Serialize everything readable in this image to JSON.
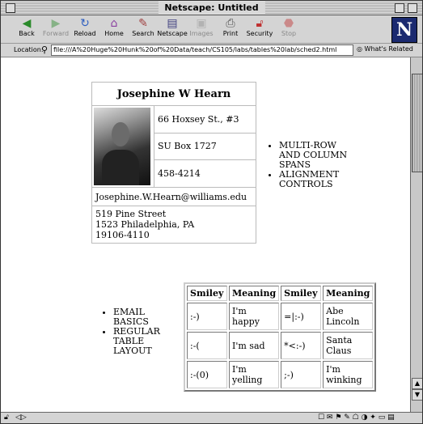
{
  "window": {
    "title": "Netscape: Untitled"
  },
  "toolbar": {
    "buttons": [
      {
        "label": "Back",
        "icon": "back-arrow-icon",
        "enabled": true
      },
      {
        "label": "Forward",
        "icon": "forward-arrow-icon",
        "enabled": false
      },
      {
        "label": "Reload",
        "icon": "reload-icon",
        "enabled": true
      },
      {
        "label": "Home",
        "icon": "home-icon",
        "enabled": true
      },
      {
        "label": "Search",
        "icon": "search-icon",
        "enabled": true
      },
      {
        "label": "Netscape",
        "icon": "netscape-icon",
        "enabled": true
      },
      {
        "label": "Images",
        "icon": "images-icon",
        "enabled": false
      },
      {
        "label": "Print",
        "icon": "print-icon",
        "enabled": true
      },
      {
        "label": "Security",
        "icon": "security-lock-icon",
        "enabled": true
      },
      {
        "label": "Stop",
        "icon": "stop-icon",
        "enabled": false
      }
    ],
    "logo_letter": "N"
  },
  "location": {
    "label": "Location:",
    "url": "file:///A%20Huge%20Hunk%20of%20Data/teach/CS105/labs/tables%20lab/sched2.html",
    "related": "What's Related"
  },
  "card": {
    "name": "Josephine W Hearn",
    "address": "66 Hoxsey St., #3",
    "su_box": "SU Box 1727",
    "phone": "458-4214",
    "email": "Josephine.W.Hearn@williams.edu",
    "home_line1": "519 Pine Street",
    "home_line2": "1523 Philadelphia, PA",
    "home_line3": "19106-4110"
  },
  "bullets_top": [
    "MULTI-ROW AND COLUMN SPANS",
    "ALIGNMENT CONTROLS"
  ],
  "bullets_bottom": [
    "EMAIL BASICS",
    "REGULAR TABLE LAYOUT"
  ],
  "smiley_table": {
    "headers": [
      "Smiley",
      "Meaning",
      "Smiley",
      "Meaning"
    ],
    "rows": [
      [
        ":-)",
        "I'm happy",
        "=|:-)",
        "Abe Lincoln"
      ],
      [
        ":-(",
        "I'm sad",
        "*<:-)",
        "Santa Claus"
      ],
      [
        ":-(0)",
        "I'm yelling",
        ";-)",
        "I'm winking"
      ]
    ]
  }
}
